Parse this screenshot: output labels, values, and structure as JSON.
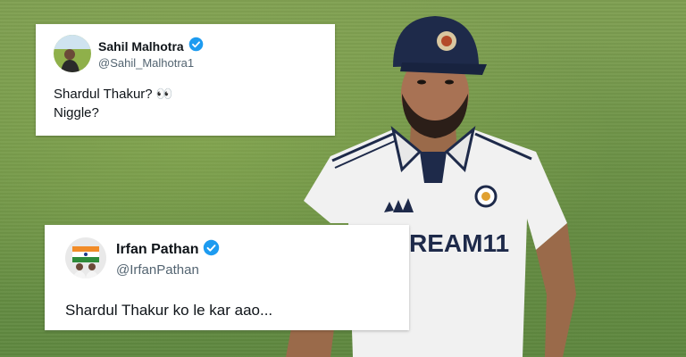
{
  "tweets": [
    {
      "name": "Sahil Malhotra",
      "handle": "@Sahil_Malhotra1",
      "lines": [
        "Shardul Thakur? 👀",
        "Niggle?"
      ],
      "verified": true
    },
    {
      "name": "Irfan Pathan",
      "handle": "@IrfanPathan",
      "lines": [
        "Shardul Thakur ko le kar aao..."
      ],
      "verified": true
    }
  ],
  "player": {
    "jersey_text": "REAM11"
  },
  "colors": {
    "verified_badge": "#1d9bf0",
    "field_green": "#6f9448",
    "cap_navy": "#1e2a4a"
  }
}
